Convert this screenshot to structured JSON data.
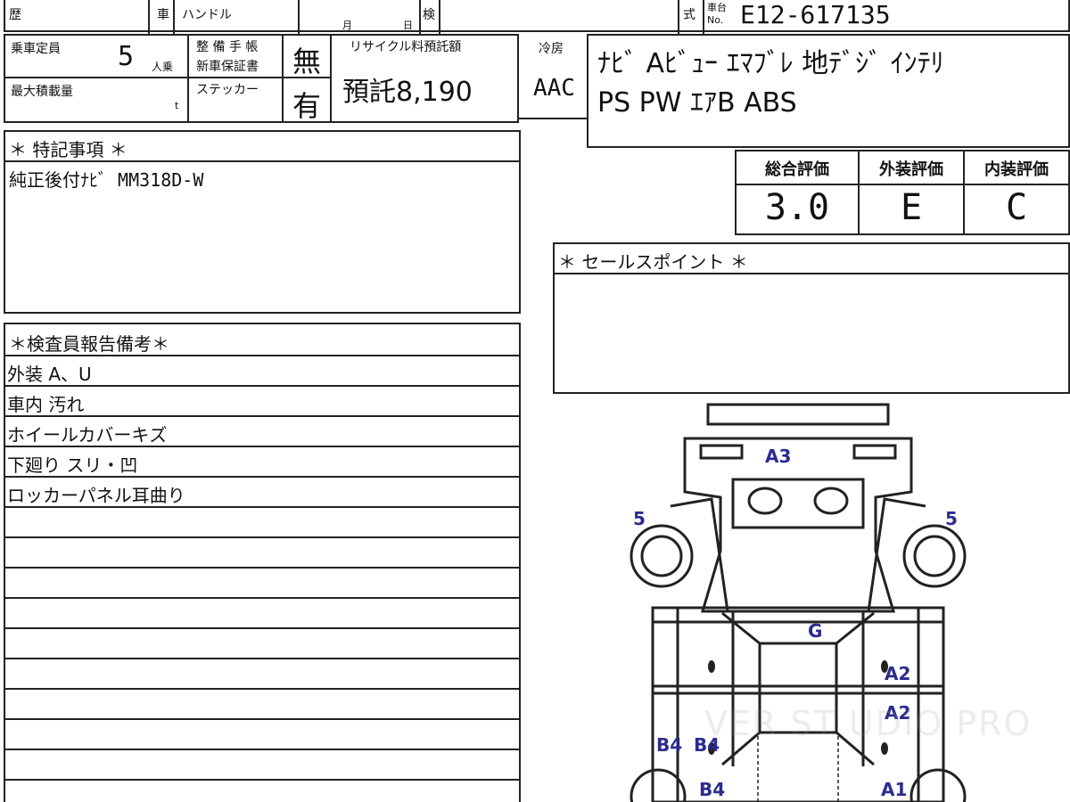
{
  "header": {
    "reki_label": "歴",
    "sha_label": "車",
    "handle_label": "ハンドル",
    "month_label": "月",
    "day_label": "日",
    "ken_label": "検",
    "shiki_label": "式",
    "chassis_label_top": "車台",
    "chassis_label_bottom": "No.",
    "chassis_number": "E12-617135"
  },
  "info": {
    "capacity_label": "乗車定員",
    "capacity_value": "5",
    "capacity_unit": "人乗",
    "max_load_label": "最大積載量",
    "max_load_unit": "t",
    "service_book_label_1": "整 備 手 帳",
    "service_book_label_2": "新車保証書",
    "service_book_value": "無",
    "sticker_label": "ステッカー",
    "sticker_value": "有",
    "recycle_label": "リサイクル料預託額",
    "recycle_value": "預託8,190",
    "aircon_label": "冷房",
    "aircon_value": "AAC"
  },
  "equipment": {
    "line1": "ﾅﾋﾞ  Aﾋﾞｭｰ  ｴﾏﾌﾞﾚ  地ﾃﾞｼﾞ  ｲﾝﾃﾘ",
    "line2": "PS  PW  ｴｱB  ABS"
  },
  "special_notes": {
    "heading": "＊ 特記事項 ＊",
    "text": "純正後付ﾅﾋﾞ  MM318D-W"
  },
  "evaluation": {
    "overall_label": "総合評価",
    "overall_value": "3.0",
    "exterior_label": "外装評価",
    "exterior_value": "E",
    "interior_label": "内装評価",
    "interior_value": "C"
  },
  "sales_point": {
    "heading": "＊ セールスポイント ＊"
  },
  "inspector_report": {
    "heading": "＊検査員報告備考＊",
    "rows": [
      "外装  A、U",
      "車内 汚れ",
      "ホイールカバーキズ",
      "下廻り スリ・凹",
      "ロッカーパネル耳曲り"
    ]
  },
  "diagram": {
    "labels": {
      "a3": "A3",
      "left_5": "5",
      "right_5": "5",
      "g": "G",
      "a2_upper": "A2",
      "a2_lower": "A2",
      "b4_left": "B4",
      "b4_right": "B4",
      "b4_bottom": "B4",
      "a1": "A1"
    }
  },
  "watermark": "VER ST UDIO PRO"
}
